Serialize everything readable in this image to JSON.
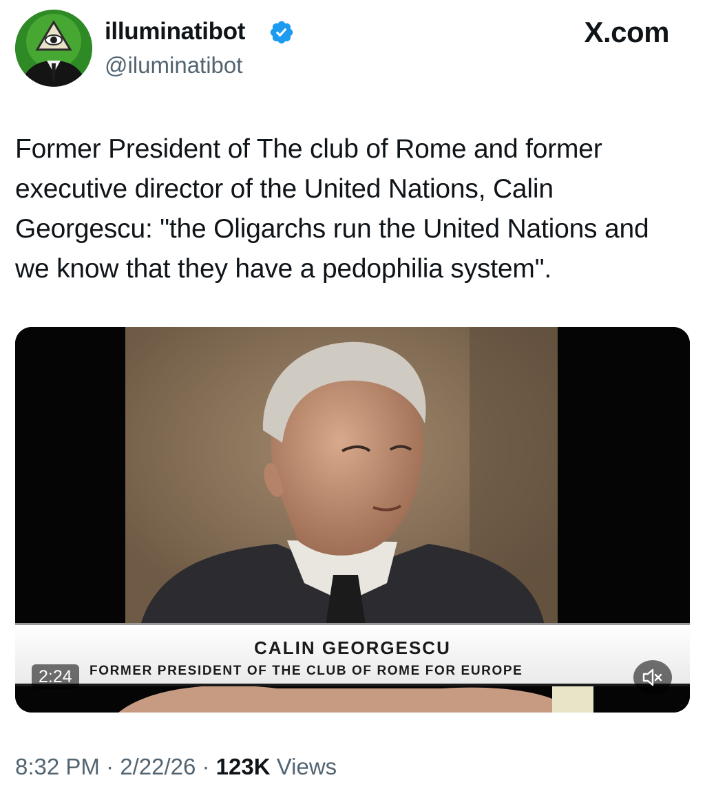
{
  "author": {
    "display_name": "illuminatibot",
    "handle": "@iluminatibot",
    "verified": true,
    "avatar_icon": "illuminati-eye-pyramid-avatar"
  },
  "brand": "X.com",
  "tweet": {
    "text": "Former President of The club of Rome and former executive director of the United Nations, Calin Georgescu: \"the Oligarchs run the United Nations and we know that they have a pedophilia system\"."
  },
  "video": {
    "caption_name": "CALIN GEORGESCU",
    "caption_role": "FORMER PRESIDENT OF THE CLUB OF ROME FOR EUROPE",
    "duration": "2:24",
    "muted": true
  },
  "meta": {
    "time": "8:32 PM",
    "separator": " · ",
    "date": "2/22/26",
    "views_count": "123K",
    "views_label": " Views"
  },
  "colors": {
    "text": "#0f1419",
    "secondary": "#536471",
    "verified_badge": "#1d9bf0"
  }
}
